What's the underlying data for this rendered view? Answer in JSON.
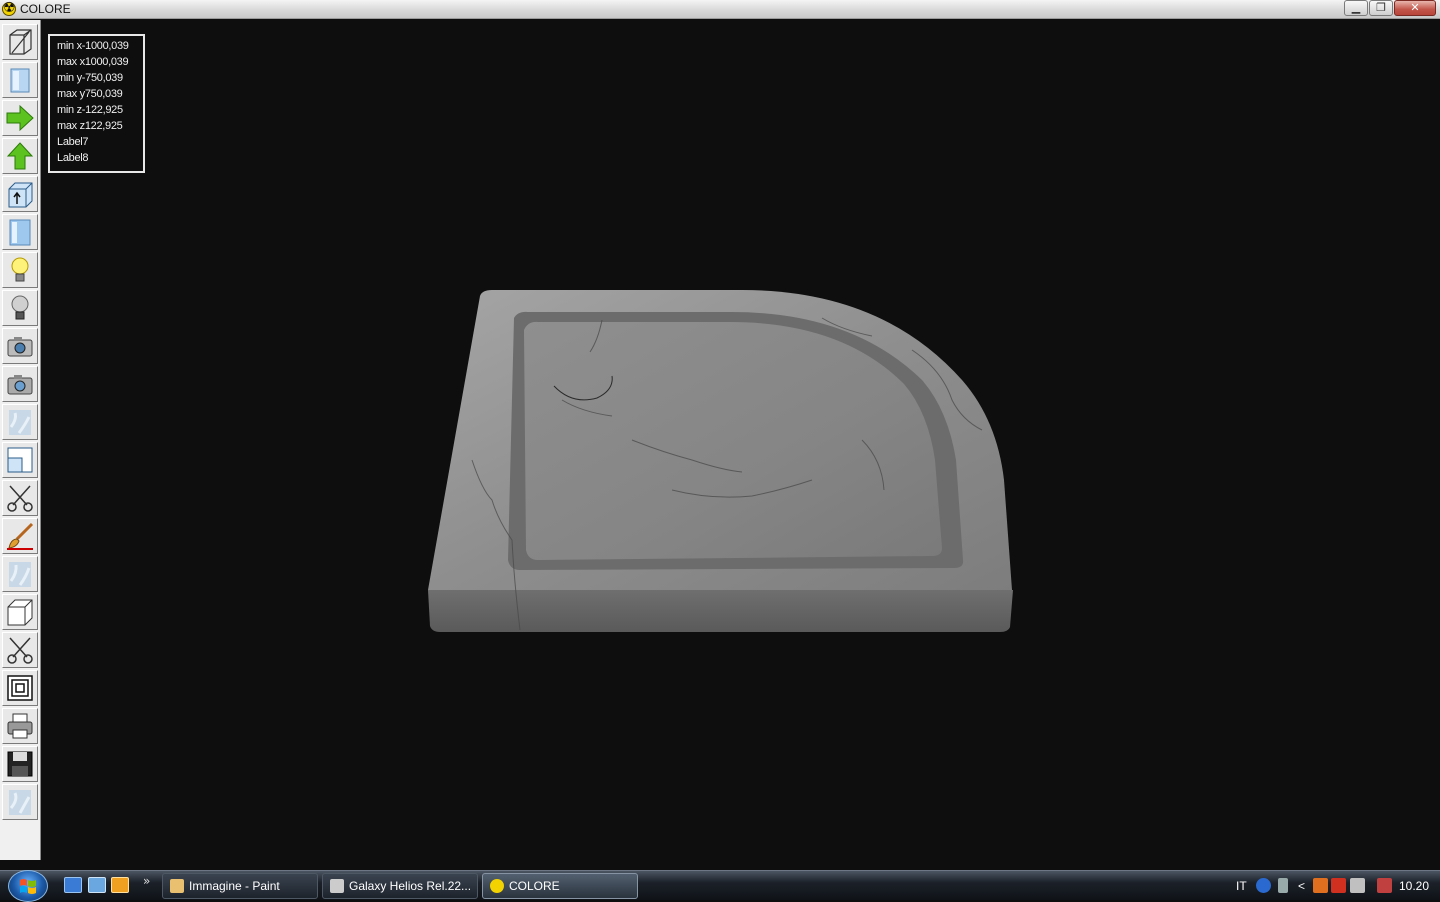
{
  "window": {
    "title": "COLORE",
    "minimize_glyph": "▁",
    "restore_glyph": "❐",
    "close_glyph": "✕"
  },
  "toolbar": {
    "items": [
      {
        "name": "wireframe-box-icon"
      },
      {
        "name": "blue-panel-icon"
      },
      {
        "name": "arrow-right-icon"
      },
      {
        "name": "arrow-up-icon"
      },
      {
        "name": "box-up-arrow-icon"
      },
      {
        "name": "blue-panel-2-icon"
      },
      {
        "name": "lightbulb-on-icon"
      },
      {
        "name": "lightbulb-off-icon"
      },
      {
        "name": "camera-icon"
      },
      {
        "name": "camera-2-icon"
      },
      {
        "name": "marble-texture-icon"
      },
      {
        "name": "window-split-icon"
      },
      {
        "name": "scissors-icon"
      },
      {
        "name": "paint-brush-icon"
      },
      {
        "name": "marble-texture-2-icon"
      },
      {
        "name": "white-box-icon"
      },
      {
        "name": "scissors-2-icon"
      },
      {
        "name": "concentric-squares-icon"
      },
      {
        "name": "printer-icon"
      },
      {
        "name": "floppy-disk-icon"
      },
      {
        "name": "marble-texture-3-icon"
      }
    ]
  },
  "info": {
    "min_x": "min x-1000,039",
    "max_x": "max x1000,039",
    "min_y": "min y-750,039",
    "max_y": "max y750,039",
    "min_z": "min z-122,925",
    "max_z": "max z122,925",
    "label7": "Label7",
    "label8": "Label8"
  },
  "taskbar": {
    "quick_chevron": "»",
    "tasks": [
      {
        "label": "Immagine - Paint",
        "active": false
      },
      {
        "label": "Galaxy Helios  Rel.22...",
        "active": false
      },
      {
        "label": "COLORE",
        "active": true
      }
    ],
    "tray": {
      "language": "IT",
      "arrow": "<",
      "time": "10.20"
    }
  },
  "colors": {
    "viewport_bg": "#0e0e0e",
    "marble_light": "#9d9d9d",
    "marble_dark": "#6a6a6a",
    "accent_green": "#5cc21f"
  }
}
